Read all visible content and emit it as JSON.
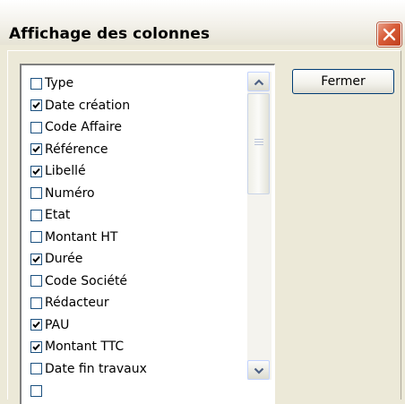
{
  "window": {
    "title": "Affichage des colonnes"
  },
  "buttons": {
    "close_label": "Fermer"
  },
  "columns": [
    {
      "label": "Type",
      "checked": false
    },
    {
      "label": "Date création",
      "checked": true
    },
    {
      "label": "Code Affaire",
      "checked": false
    },
    {
      "label": "Référence",
      "checked": true
    },
    {
      "label": "Libellé",
      "checked": true
    },
    {
      "label": "Numéro",
      "checked": false
    },
    {
      "label": "Etat",
      "checked": false
    },
    {
      "label": "Montant HT",
      "checked": false
    },
    {
      "label": "Durée",
      "checked": true
    },
    {
      "label": "Code Société",
      "checked": false
    },
    {
      "label": "Rédacteur",
      "checked": false
    },
    {
      "label": "PAU",
      "checked": true
    },
    {
      "label": "Montant TTC",
      "checked": true
    },
    {
      "label": "Date fin travaux",
      "checked": false
    },
    {
      "label": "",
      "checked": false
    }
  ],
  "colors": {
    "window_bg": "#ece9d8",
    "close_button_red": "#d85b38",
    "checkbox_border": "#1c5180"
  },
  "icons": {
    "close": "close-x-icon",
    "scroll_up": "chevron-up-icon",
    "scroll_down": "chevron-down-icon",
    "checkmark": "checkmark-icon"
  }
}
